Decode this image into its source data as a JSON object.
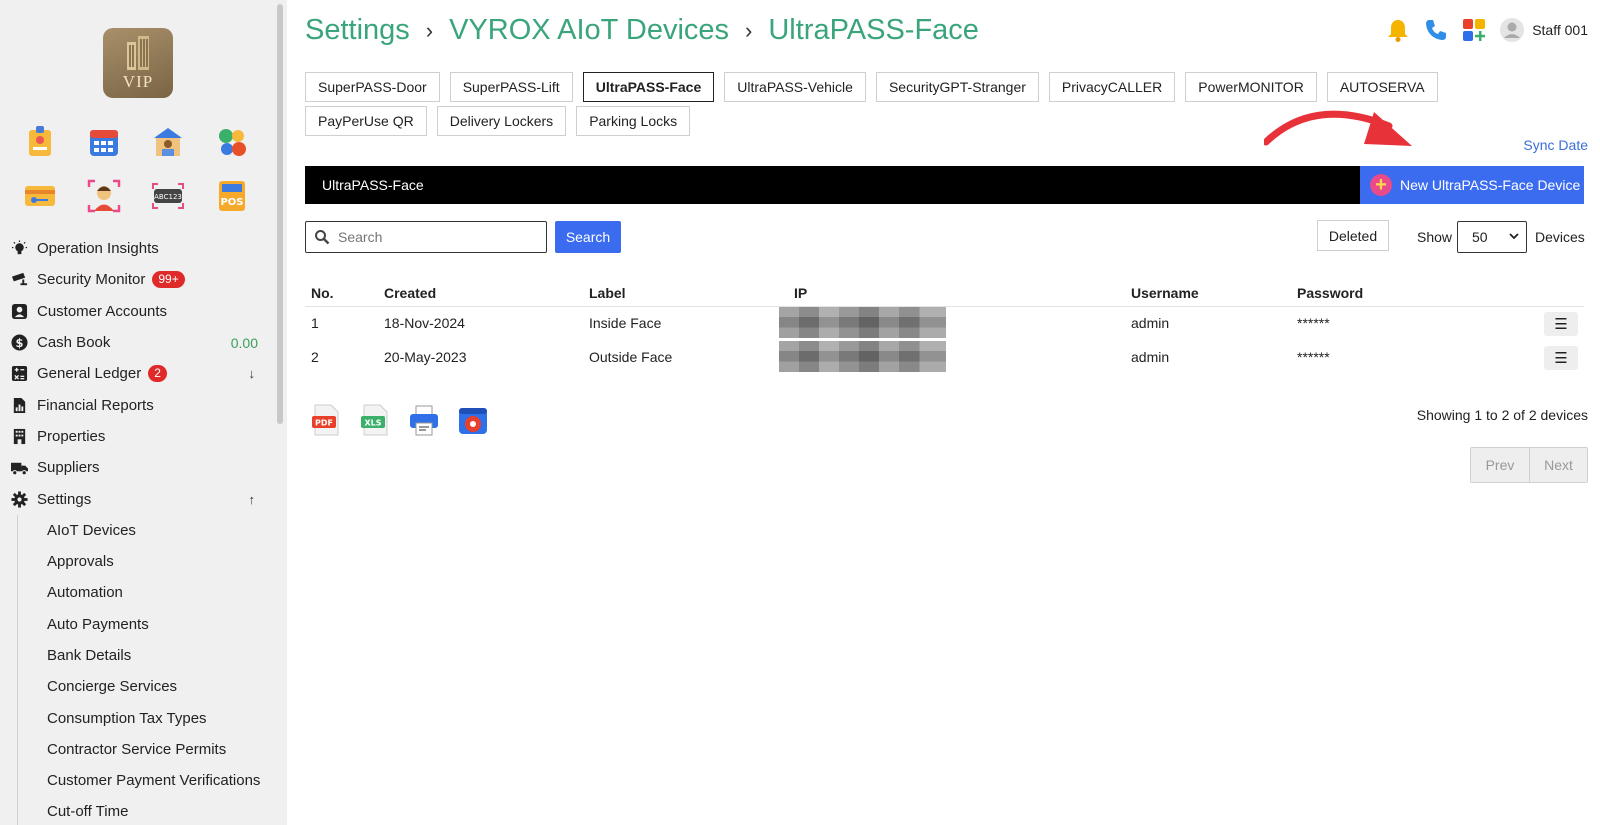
{
  "logo": {
    "text": "VIP"
  },
  "sidebar": {
    "items": [
      {
        "label": "Operation Insights",
        "icon": "lightbulb-icon"
      },
      {
        "label": "Security Monitor",
        "icon": "cctv-icon",
        "badge": "99+"
      },
      {
        "label": "Customer Accounts",
        "icon": "user-card-icon"
      },
      {
        "label": "Cash Book",
        "icon": "dollar-icon",
        "value": "0.00"
      },
      {
        "label": "General Ledger",
        "icon": "calculator-icon",
        "badge": "2",
        "arrow": "↓"
      },
      {
        "label": "Financial Reports",
        "icon": "report-icon"
      },
      {
        "label": "Properties",
        "icon": "building-icon"
      },
      {
        "label": "Suppliers",
        "icon": "truck-icon"
      },
      {
        "label": "Settings",
        "icon": "gear-icon",
        "arrow": "↑"
      }
    ],
    "sub_items": [
      "AIoT Devices",
      "Approvals",
      "Automation",
      "Auto Payments",
      "Bank Details",
      "Concierge Services",
      "Consumption Tax Types",
      "Contractor Service Permits",
      "Customer Payment Verifications",
      "Cut-off Time"
    ]
  },
  "breadcrumb": {
    "part1": "Settings",
    "part2": "VYROX AIoT Devices",
    "part3": "UltraPASS-Face",
    "sep": "›"
  },
  "user": {
    "name": "Staff 001"
  },
  "tabs": [
    "SuperPASS-Door",
    "SuperPASS-Lift",
    "UltraPASS-Face",
    "UltraPASS-Vehicle",
    "SecurityGPT-Stranger",
    "PrivacyCALLER",
    "PowerMONITOR",
    "AUTOSERVA",
    "PayPerUse QR",
    "Delivery Lockers",
    "Parking Locks"
  ],
  "active_tab": "UltraPASS-Face",
  "sync_label": "Sync Date",
  "section": {
    "title": "UltraPASS-Face",
    "new_button": "New UltraPASS-Face Device"
  },
  "search": {
    "placeholder": "Search",
    "button": "Search"
  },
  "deleted_label": "Deleted",
  "show": {
    "label": "Show",
    "value": "50",
    "suffix": "Devices"
  },
  "table": {
    "headers": {
      "no": "No.",
      "created": "Created",
      "label": "Label",
      "ip": "IP",
      "username": "Username",
      "password": "Password"
    },
    "rows": [
      {
        "no": "1",
        "created": "18-Nov-2024",
        "label": "Inside Face",
        "username": "admin",
        "password": "******"
      },
      {
        "no": "2",
        "created": "20-May-2023",
        "label": "Outside Face",
        "username": "admin",
        "password": "******"
      }
    ],
    "row_menu": "☰"
  },
  "exports": [
    "pdf-icon",
    "xls-icon",
    "printer-icon",
    "settings-icon"
  ],
  "export_labels": {
    "pdf": "PDF",
    "xls": "XLS"
  },
  "showing_text": "Showing 1 to 2 of 2 devices",
  "pager": {
    "prev": "Prev",
    "next": "Next"
  },
  "colors": {
    "accent_green": "#3aa57a",
    "primary_blue": "#3b6cf0",
    "badge_red": "#e02a2a"
  }
}
